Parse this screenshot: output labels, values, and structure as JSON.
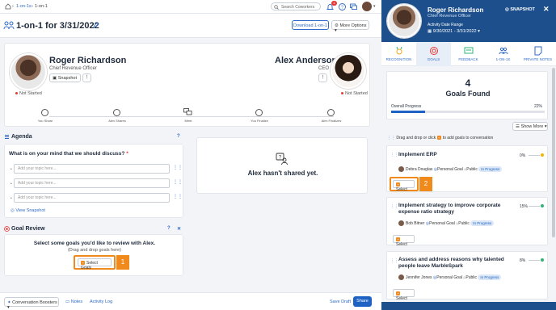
{
  "breadcrumb": {
    "items": [
      "1-on-1s",
      "1-on-1"
    ]
  },
  "topbar": {
    "search_placeholder": "Search Coworkers",
    "notification_count": "4"
  },
  "header": {
    "title": "1-on-1 for 3/31/2022",
    "download_label": "Download 1-on-1",
    "more_options_label": "More Options"
  },
  "participants": {
    "me": {
      "name": "Roger Richardson",
      "role": "Chief Revenue Officer",
      "status": "Not Started",
      "snapshot_label": "Snapshot"
    },
    "other": {
      "name": "Alex Anderson",
      "role": "CEO",
      "status": "Not Started"
    }
  },
  "steps": [
    {
      "label": "You Share"
    },
    {
      "label": "Alex Shares"
    },
    {
      "label": "Meet"
    },
    {
      "label": "You Finalize"
    },
    {
      "label": "Alex Finalizes"
    }
  ],
  "agenda": {
    "title": "Agenda",
    "help": "?",
    "question": "What is on your mind that we should discuss?",
    "required_mark": "*",
    "inputs": [
      {
        "placeholder": "Add your topic here..."
      },
      {
        "placeholder": "Add your topic here..."
      },
      {
        "placeholder": "Add your topic here..."
      }
    ],
    "view_snapshot_label": "View Snapshot"
  },
  "not_shared": {
    "message": "Alex hasn't shared yet."
  },
  "goal_review": {
    "title": "Goal Review",
    "help": "?",
    "close": "✕",
    "prompt": "Select some goals you'd like to review with Alex.",
    "hint": "(Drag and drop goals here)",
    "select_label": "Select Goals",
    "callout_number": "1"
  },
  "footer": {
    "boosters_label": "Conversation Boosters",
    "notes_label": "Notes",
    "activity_label": "Activity Log",
    "save_label": "Save Draft",
    "share_label": "Share"
  },
  "panel": {
    "name": "Roger Richardson",
    "role": "Chief Revenue Officer",
    "snapshot_label": "SNAPSHOT",
    "date_range_label": "Activity Date Range",
    "date_range": "9/30/2021 - 3/31/2022",
    "tabs": [
      {
        "label": "RECOGNITION"
      },
      {
        "label": "GOALS"
      },
      {
        "label": "FEEDBACK"
      },
      {
        "label": "1-ON-1S"
      },
      {
        "label": "PRIVATE NOTES"
      }
    ],
    "goals_count": "4",
    "goals_found_label": "Goals Found",
    "overall_label": "Overall Progress",
    "overall_pct": "22%",
    "overall_value": 0.22,
    "show_more_label": "Show More",
    "drag_hint": "Drag and drop or click",
    "drag_hint_end": "to add goals to conversation",
    "select_label": "Select",
    "callout_number": "2",
    "goals": [
      {
        "title": "Implement ERP",
        "pct": "0%",
        "owner": "Debra Douglas",
        "type": "Personal Goal",
        "visibility": "Public",
        "status": "In Progress",
        "status_color": "#f5b400"
      },
      {
        "title": "Implement strategy to improve corporate expense ratio strategy",
        "pct": "15%",
        "owner": "Bob Bitner",
        "type": "Personal Goal",
        "visibility": "Public",
        "status": "In Progress",
        "status_color": "#2bb673"
      },
      {
        "title": "Assess and address reasons why talented people leave MarbleSpark",
        "pct": "8%",
        "owner": "Jennifer Jones",
        "type": "Personal Goal",
        "visibility": "Public",
        "status": "In Progress",
        "status_color": "#2bb673"
      }
    ]
  }
}
